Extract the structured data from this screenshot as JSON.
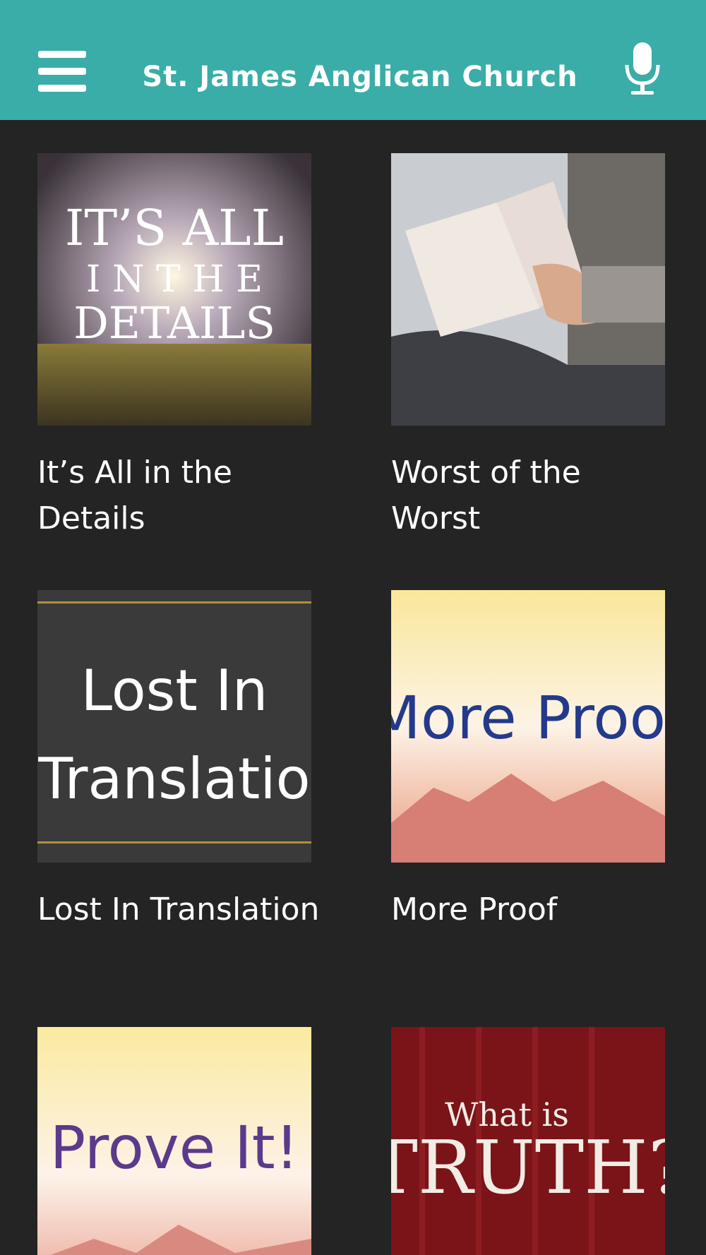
{
  "header": {
    "title": "St. James Anglican Church",
    "background": "#3aada8"
  },
  "series": [
    {
      "caption": "It’s All in the Details",
      "art_lines": [
        "IT’S ALL",
        "I N  T H E",
        "DETAILS"
      ]
    },
    {
      "caption": "Worst of the Worst"
    },
    {
      "caption": "Lost In Translation",
      "art_lines": [
        "Lost In",
        "Translatio"
      ]
    },
    {
      "caption": "More Proof",
      "art_lines": [
        "More Proof"
      ]
    },
    {
      "caption": "",
      "art_lines": [
        "Prove It!"
      ]
    },
    {
      "caption": "",
      "art_lines": [
        "What is",
        "TRUTH?"
      ]
    }
  ],
  "icons": {
    "menu": "hamburger-menu-icon",
    "mic": "microphone-icon"
  }
}
